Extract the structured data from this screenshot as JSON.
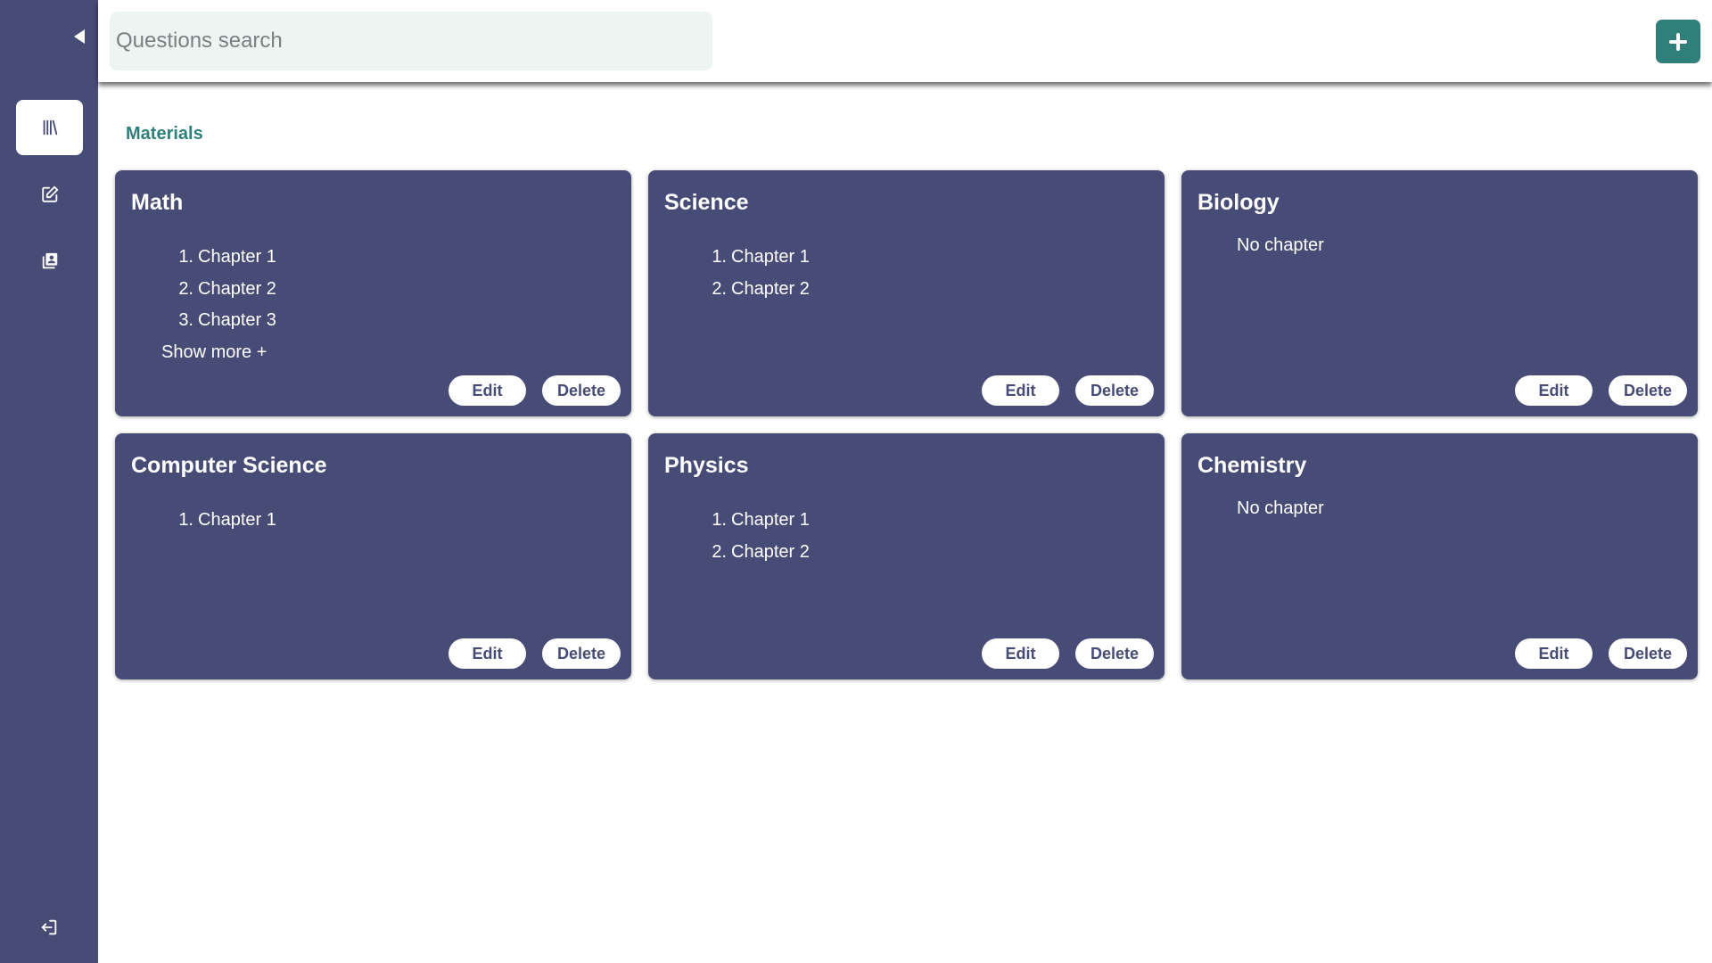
{
  "colors": {
    "sidebar": "#474c77",
    "card": "#474c77",
    "accent": "#2f7f7a",
    "search_bg": "#eef4f2"
  },
  "sidebar": {
    "collapse_icon": "caret-left-icon",
    "items": [
      {
        "name": "library",
        "icon": "library-icon",
        "active": true
      },
      {
        "name": "edit",
        "icon": "edit-icon",
        "active": false
      },
      {
        "name": "profile",
        "icon": "profile-card-icon",
        "active": false
      }
    ],
    "logout_icon": "logout-icon"
  },
  "header": {
    "search_placeholder": "Questions search",
    "add_icon": "plus-icon"
  },
  "main": {
    "section_title": "Materials",
    "edit_label": "Edit",
    "delete_label": "Delete",
    "cards": [
      {
        "title": "Math",
        "chapters": [
          "1.",
          "Chapter 1",
          "2.",
          "Chapter 2",
          "3.",
          "Chapter 3"
        ],
        "show_more": "Show more +"
      },
      {
        "title": "Science",
        "chapters": [
          "1.",
          "Chapter 1",
          "2.",
          "Chapter 2"
        ]
      },
      {
        "title": "Biology",
        "empty_text": "No chapter"
      },
      {
        "title": "Computer Science",
        "chapters": [
          "1.",
          "Chapter 1"
        ]
      },
      {
        "title": "Physics",
        "chapters": [
          "1.",
          "Chapter 1",
          "2.",
          "Chapter 2"
        ]
      },
      {
        "title": "Chemistry",
        "empty_text": "No chapter"
      }
    ]
  }
}
